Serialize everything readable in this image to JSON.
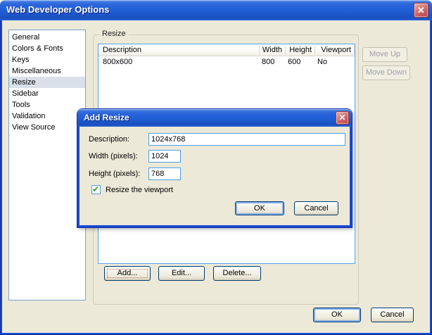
{
  "window": {
    "title": "Web Developer Options"
  },
  "icons": {
    "close": "✕",
    "check": "✔"
  },
  "colors": {
    "frame_blue": "#1A49D4",
    "client_bg": "#ECE9D8",
    "selection_bg": "#D9E0EA",
    "focus_border_blue": "#4E9EE8",
    "close_button_red": "#C75A5C",
    "check_green": "#2DA12D"
  },
  "sidebar": {
    "items": [
      "General",
      "Colors & Fonts",
      "Keys",
      "Miscellaneous",
      "Resize",
      "Sidebar",
      "Tools",
      "Validation",
      "View Source"
    ],
    "selected": "Resize"
  },
  "resize_group": {
    "title": "Resize",
    "table": {
      "columns": [
        "Description",
        "Width",
        "Height",
        "Viewport"
      ],
      "rows": [
        {
          "description": "800x600",
          "width": "800",
          "height": "600",
          "viewport": "No"
        }
      ]
    },
    "move_up": "Move Up",
    "move_down": "Move Down",
    "add": "Add...",
    "edit": "Edit...",
    "delete": "Delete..."
  },
  "dialog": {
    "title": "Add Resize",
    "fields": {
      "description": {
        "label": "Description:",
        "value": "1024x768"
      },
      "width": {
        "label": "Width (pixels):",
        "value": "1024"
      },
      "height": {
        "label": "Height (pixels):",
        "value": "768"
      }
    },
    "viewport_checkbox": {
      "label": "Resize the viewport",
      "checked": true
    },
    "ok": "OK",
    "cancel": "Cancel"
  },
  "footer": {
    "ok": "OK",
    "cancel": "Cancel"
  }
}
